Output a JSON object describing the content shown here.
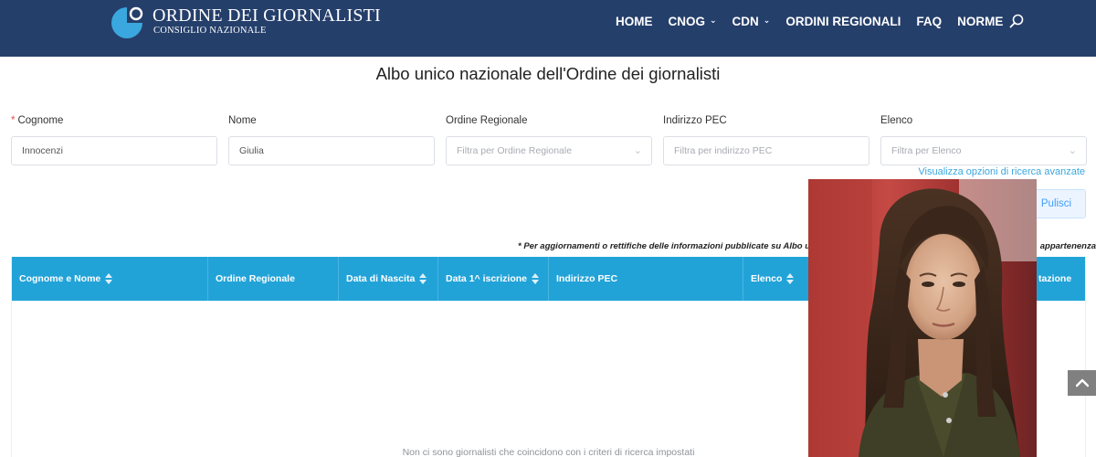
{
  "header": {
    "brand_title": "ORDINE DEI GIORNALISTI",
    "brand_subtitle": "CONSIGLIO NAZIONALE",
    "logo_icon": "circle-logo-icon",
    "nav": [
      {
        "label": "HOME",
        "has_dropdown": false
      },
      {
        "label": "CNOG",
        "has_dropdown": true
      },
      {
        "label": "CDN",
        "has_dropdown": true
      },
      {
        "label": "ORDINI REGIONALI",
        "has_dropdown": false
      },
      {
        "label": "FAQ",
        "has_dropdown": false
      },
      {
        "label": "NORME",
        "has_dropdown": false
      }
    ],
    "search_icon": "search-icon"
  },
  "page_title": "Albo unico nazionale dell'Ordine dei giornalisti",
  "form": {
    "fields": [
      {
        "label": "Cognome",
        "required": "*",
        "value": "Innocenzi",
        "placeholder": "",
        "type": "text"
      },
      {
        "label": "Nome",
        "required": "",
        "value": "Giulia",
        "placeholder": "",
        "type": "text"
      },
      {
        "label": "Ordine Regionale",
        "required": "",
        "value": "",
        "placeholder": "Filtra per Ordine Regionale",
        "type": "select"
      },
      {
        "label": "Indirizzo PEC",
        "required": "",
        "value": "",
        "placeholder": "Filtra per indirizzo PEC",
        "type": "text"
      },
      {
        "label": "Elenco",
        "required": "",
        "value": "",
        "placeholder": "Filtra per Elenco",
        "type": "select"
      }
    ],
    "advanced_link": "Visualizza opzioni di ricerca avanzate",
    "clear_label": "Pulisci"
  },
  "notice": {
    "text": "* Per aggiornamenti o rettifiche delle informazioni pubblicate su Albo unico",
    "tail": "appartenenza"
  },
  "table": {
    "columns": [
      {
        "label": "Cognome e Nome",
        "sortable": true
      },
      {
        "label": "Ordine Regionale",
        "sortable": false
      },
      {
        "label": "Data di Nascita",
        "sortable": true
      },
      {
        "label": "Data 1^ iscrizione",
        "sortable": true
      },
      {
        "label": "Indirizzo PEC",
        "sortable": false
      },
      {
        "label": "Elenco",
        "sortable": true
      },
      {
        "label": "",
        "sortable": false
      },
      {
        "label": "tazione",
        "sortable": false
      }
    ],
    "empty_text": "Non ci sono giornalisti che coincidono con i criteri di ricerca impostati"
  },
  "colors": {
    "header_bg": "#253f6b",
    "table_header_bg": "#22a3d8",
    "logo_blue": "#3aa7de",
    "link_blue": "#3aa7de"
  }
}
